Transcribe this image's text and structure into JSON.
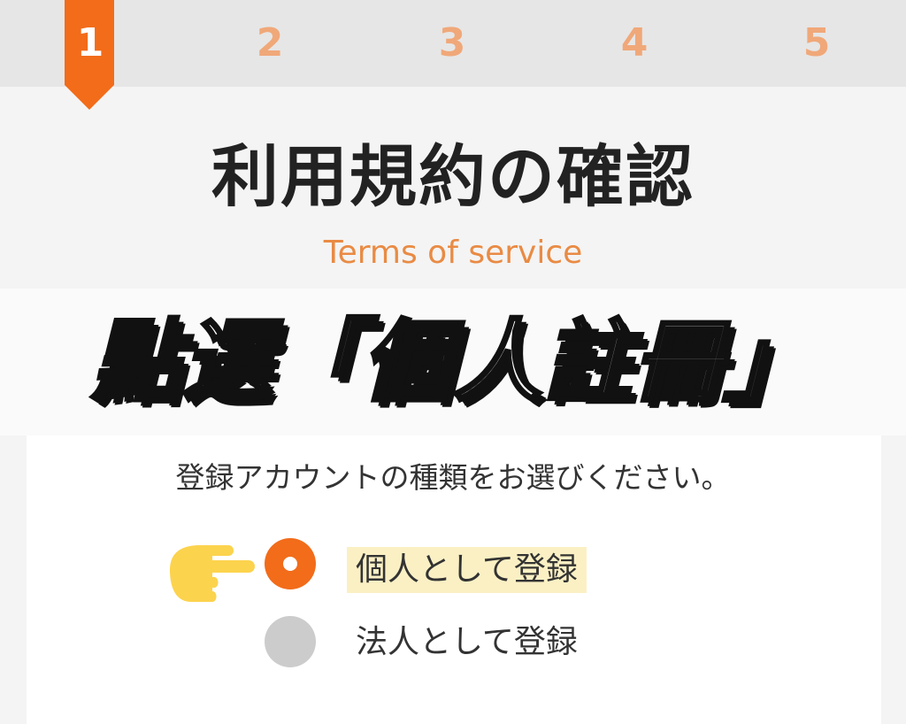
{
  "steps": [
    "1",
    "2",
    "3",
    "4",
    "5"
  ],
  "active_step": 1,
  "header": {
    "title": "利用規約の確認",
    "subtitle": "Terms of service"
  },
  "overlay": {
    "caption": "點選「個人註冊」"
  },
  "form": {
    "prompt": "登録アカウントの種類をお選びください。",
    "options": [
      {
        "label": "個人として登録",
        "selected": true
      },
      {
        "label": "法人として登録",
        "selected": false
      }
    ]
  },
  "icons": {
    "pointer": "pointing-hand-icon"
  },
  "colors": {
    "accent": "#f26c1a",
    "accent_light": "#f0a879",
    "subtitle": "#e98b44",
    "radio_unselected": "#cccccc",
    "highlight": "#fbf0c4",
    "pointer_hand": "#fcd34d"
  }
}
